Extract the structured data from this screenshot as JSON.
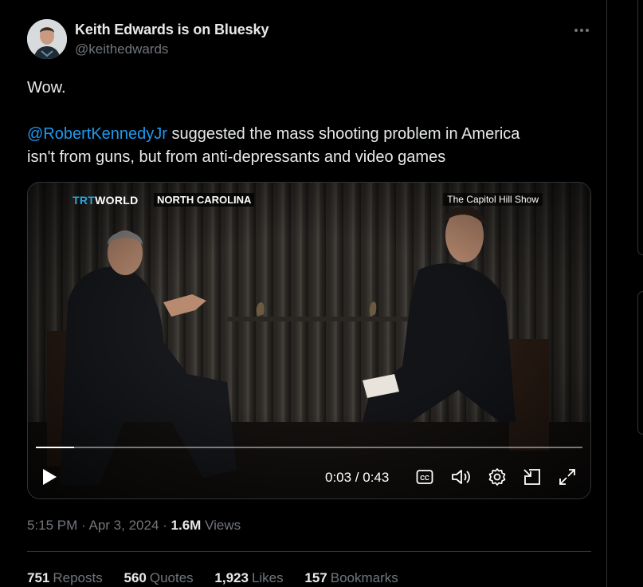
{
  "author": {
    "display_name": "Keith Edwards is on Bluesky",
    "handle": "@keithedwards"
  },
  "tweet": {
    "line1": "Wow.",
    "mention": "@RobertKennedyJr",
    "line2_rest": " suggested the mass shooting problem in America",
    "line3": "isn't from guns, but from anti-depressants and video games"
  },
  "video": {
    "brand_prefix": "TRT",
    "brand_suffix": "WORLD",
    "region_label": "NORTH CAROLINA",
    "show_label": "The Capitol Hill Show",
    "timecode": "0:03 / 0:43",
    "progress_fraction": 0.07
  },
  "meta": {
    "time": "5:15 PM",
    "date": "Apr 3, 2024",
    "views_count": "1.6M",
    "views_label": "Views"
  },
  "stats": [
    {
      "count": "751",
      "label": "Reposts"
    },
    {
      "count": "560",
      "label": "Quotes"
    },
    {
      "count": "1,923",
      "label": "Likes"
    },
    {
      "count": "157",
      "label": "Bookmarks"
    }
  ],
  "icons": {
    "more": "more-dots-icon",
    "play": "play-icon",
    "captions": "captions-icon",
    "volume": "volume-icon",
    "settings": "gear-icon",
    "pip": "pip-icon",
    "fullscreen": "fullscreen-icon"
  },
  "colors": {
    "background": "#000000",
    "text": "#e7e9ea",
    "secondary": "#71767b",
    "link": "#1d9bf0",
    "border": "#2f3336"
  }
}
